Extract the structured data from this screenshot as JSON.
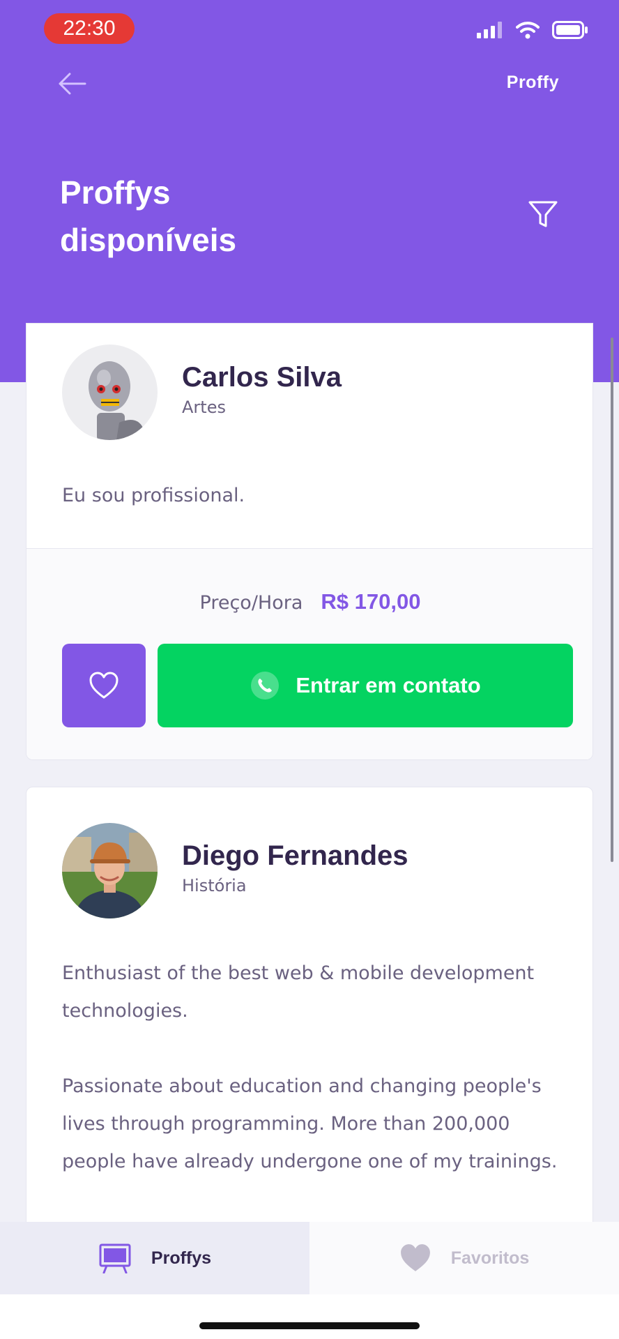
{
  "status_bar": {
    "time": "22:30"
  },
  "topbar": {
    "brand": "Proffy"
  },
  "header": {
    "title_line1": "Proffys",
    "title_line2": "disponíveis"
  },
  "cards": [
    {
      "name": "Carlos Silva",
      "subject": "Artes",
      "bio": [
        "Eu sou profissional."
      ],
      "price_label": "Preço/Hora",
      "price": "R$ 170,00",
      "contact_label": "Entrar em contato"
    },
    {
      "name": "Diego Fernandes",
      "subject": "História",
      "bio": [
        "Enthusiast of the best web & mobile development technologies.",
        "Passionate about education and changing people's lives through programming. More than 200,000 people have already undergone one of my trainings."
      ]
    }
  ],
  "tabbar": {
    "tabs": [
      {
        "label": "Proffys"
      },
      {
        "label": "Favoritos"
      }
    ]
  },
  "colors": {
    "primary": "#8257E5",
    "secondary": "#04D361",
    "title": "#32264D",
    "text": "#6A6180",
    "status_pill": "#E53935",
    "tab_inactive": "#C1BCCC"
  },
  "icons": {
    "status": [
      "signal-icon",
      "wifi-icon",
      "battery-icon"
    ],
    "topbar": "back-arrow-icon",
    "header": "filter-icon",
    "card_actions": [
      "heart-icon",
      "whatsapp-icon"
    ],
    "tabs": [
      "easel-icon",
      "heart-icon"
    ]
  }
}
